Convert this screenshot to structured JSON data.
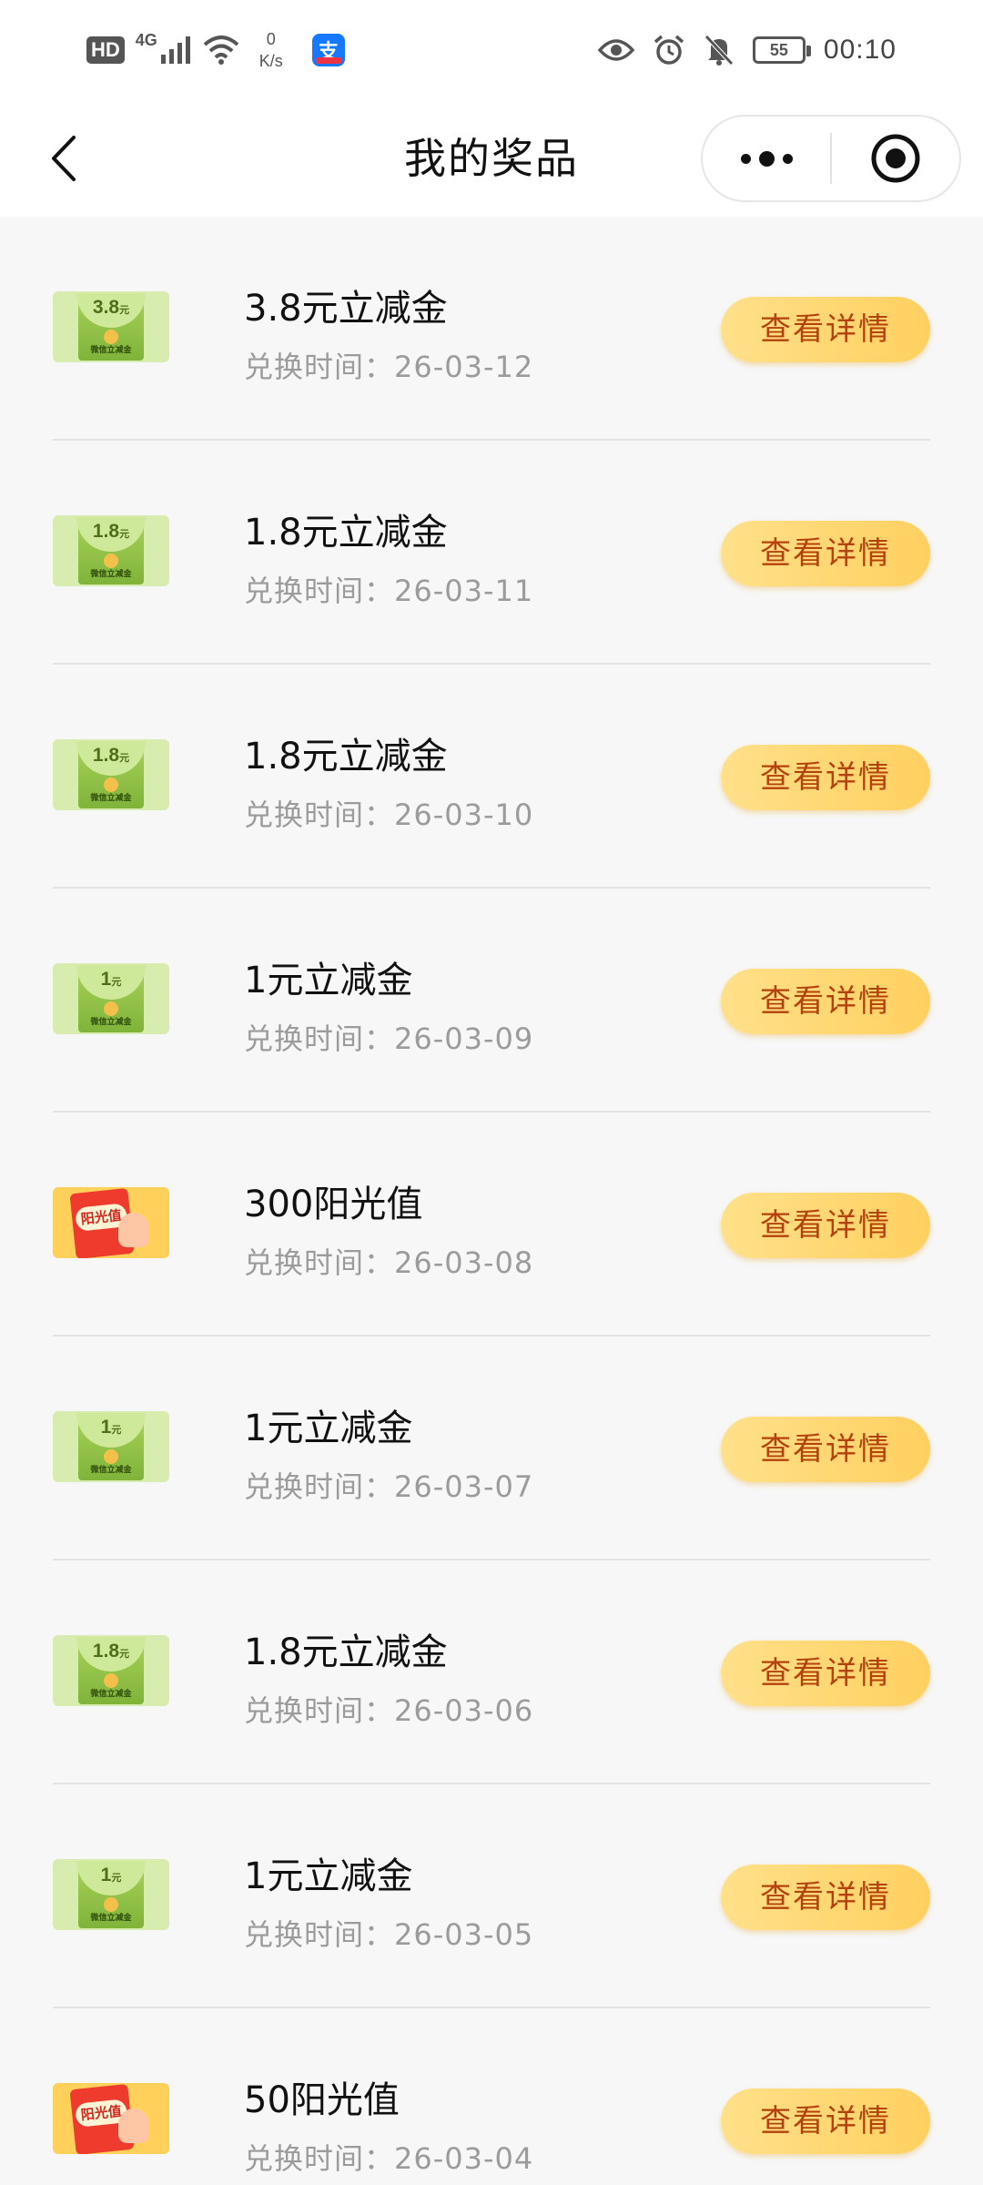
{
  "status_bar": {
    "hd": "HD",
    "network": "4G",
    "speed_value": "0",
    "speed_unit": "K/s",
    "battery": "55",
    "time": "00:10"
  },
  "nav": {
    "title": "我的奖品"
  },
  "detail_label": "查看详情",
  "time_prefix": "兑换时间：",
  "prizes": [
    {
      "title": "3.8元立减金",
      "time": "26-03-12",
      "kind": "coupon",
      "amount": "3.8",
      "unit": "元",
      "caption": "微信立减金"
    },
    {
      "title": "1.8元立减金",
      "time": "26-03-11",
      "kind": "coupon",
      "amount": "1.8",
      "unit": "元",
      "caption": "微信立减金"
    },
    {
      "title": "1.8元立减金",
      "time": "26-03-10",
      "kind": "coupon",
      "amount": "1.8",
      "unit": "元",
      "caption": "微信立减金"
    },
    {
      "title": "1元立减金",
      "time": "26-03-09",
      "kind": "coupon",
      "amount": "1",
      "unit": "元",
      "caption": "微信立减金"
    },
    {
      "title": "300阳光值",
      "time": "26-03-08",
      "kind": "sunshine",
      "badge": "阳光值"
    },
    {
      "title": "1元立减金",
      "time": "26-03-07",
      "kind": "coupon",
      "amount": "1",
      "unit": "元",
      "caption": "微信立减金"
    },
    {
      "title": "1.8元立减金",
      "time": "26-03-06",
      "kind": "coupon",
      "amount": "1.8",
      "unit": "元",
      "caption": "微信立减金"
    },
    {
      "title": "1元立减金",
      "time": "26-03-05",
      "kind": "coupon",
      "amount": "1",
      "unit": "元",
      "caption": "微信立减金"
    },
    {
      "title": "50阳光值",
      "time": "26-03-04",
      "kind": "sunshine",
      "badge": "阳光值"
    }
  ]
}
